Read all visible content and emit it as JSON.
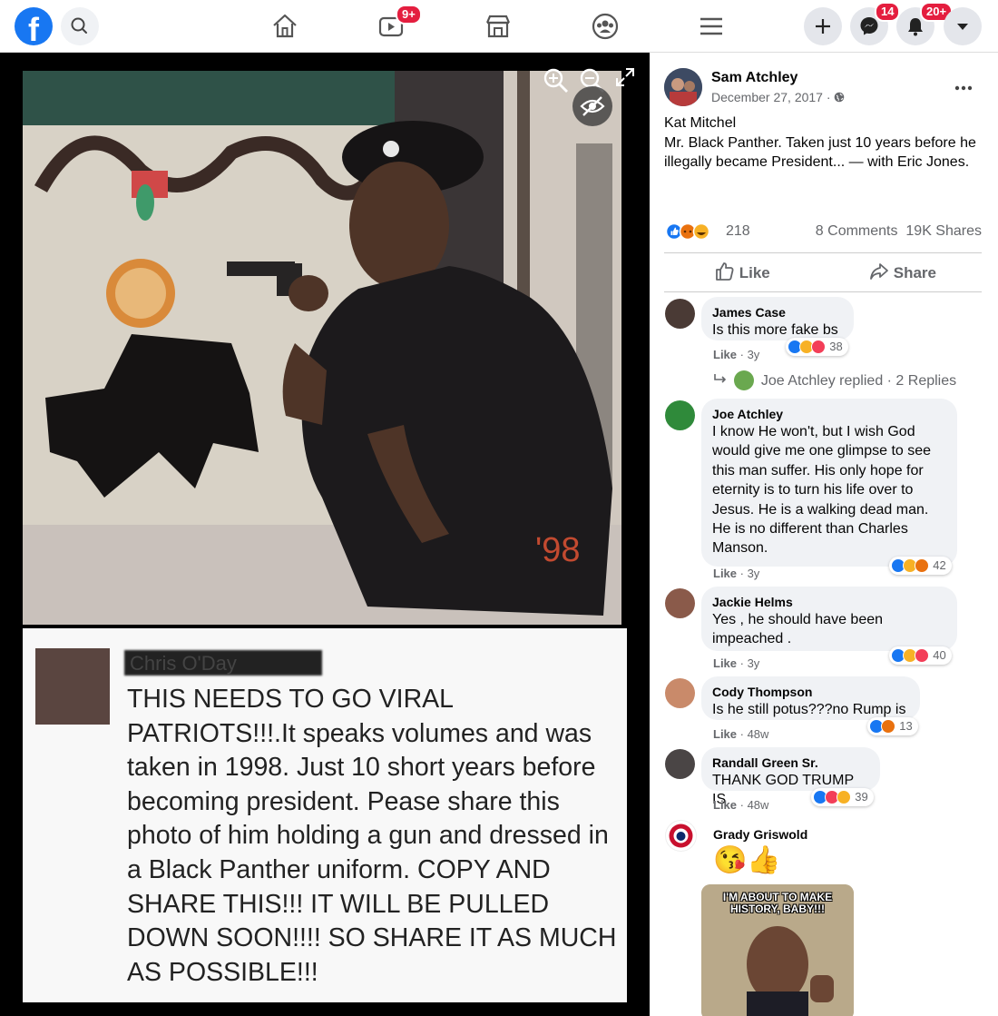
{
  "topbar": {
    "logo": "f",
    "video_badge": "9+",
    "messenger_badge": "14",
    "notifications_badge": "20+"
  },
  "photo": {
    "watermark_year": "'98",
    "poster_name": "Chris O'Day",
    "post_text": "THIS NEEDS TO GO VIRAL PATRIOTS!!!.It speaks volumes and was taken in 1998. Just 10 short years before becoming president. Pease share this photo of him holding a gun and dressed in a Black Panther uniform. COPY AND SHARE THIS!!! IT WILL BE PULLED DOWN SOON!!!! SO SHARE IT AS MUCH AS POSSIBLE!!!"
  },
  "post": {
    "author": "Sam Atchley",
    "date": "December 27, 2017 ·",
    "caption_line1": "Kat Mitchel",
    "caption_line2": "Mr. Black Panther. Taken just 10 years before he illegally became President... — with Eric Jones.",
    "reactions_count": "218",
    "comments_count": "8 Comments",
    "shares_count": "19K Shares",
    "like_label": "Like",
    "share_label": "Share"
  },
  "comments": [
    {
      "name": "James Case",
      "text": "Is this more fake bs",
      "meta_like": "Like",
      "meta_time": "· 3y",
      "reactions": "38"
    },
    {
      "name": "Joe Atchley",
      "text": "I know He won't, but I wish God would give me one glimpse to see this man suffer. His only hope for eternity is to turn his life over to Jesus. He is a walking dead man. He is no different than Charles Manson.",
      "meta_like": "Like",
      "meta_time": "· 3y",
      "reactions": "42"
    },
    {
      "name": "Jackie Helms",
      "text": "Yes , he should have been impeached .",
      "meta_like": "Like",
      "meta_time": "· 3y",
      "reactions": "40"
    },
    {
      "name": "Cody Thompson",
      "text": "Is he still potus???no Rump is",
      "meta_like": "Like",
      "meta_time": "· 48w",
      "reactions": "13"
    },
    {
      "name": "Randall Green Sr.",
      "text": "THANK GOD TRUMP IS",
      "meta_like": "Like",
      "meta_time": "· 48w",
      "reactions": "39"
    },
    {
      "name": "Grady Griswold",
      "text": "😘👍"
    }
  ],
  "replies_text": "Joe Atchley replied · 2 Replies",
  "meme_caption": "I'M ABOUT TO MAKE HISTORY, BABY!!!",
  "colors": {
    "brand": "#1877f2",
    "badge": "#e41e3f"
  }
}
